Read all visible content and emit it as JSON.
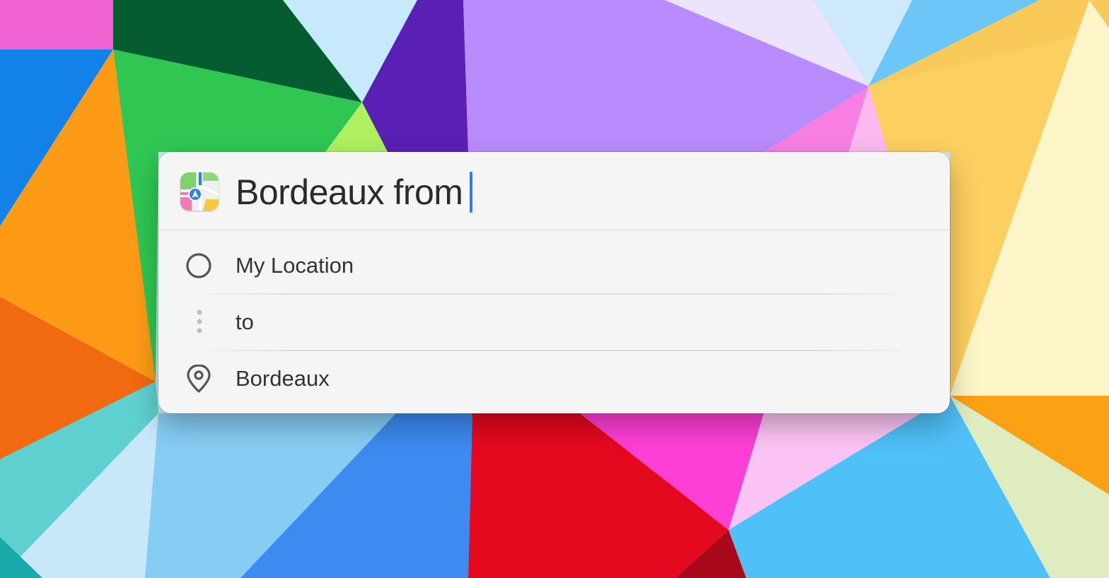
{
  "spotlight": {
    "app_icon": "maps-app-icon",
    "query": "Bordeaux from",
    "rows": [
      {
        "icon": "circle-icon",
        "label": "My Location"
      },
      {
        "icon": "vertical-dots-icon",
        "label": "to"
      },
      {
        "icon": "location-pin-icon",
        "label": "Bordeaux"
      }
    ]
  },
  "colors": {
    "caret": "#2f7cf6",
    "panel_background": "#f5f5f5",
    "text": "#333333"
  }
}
